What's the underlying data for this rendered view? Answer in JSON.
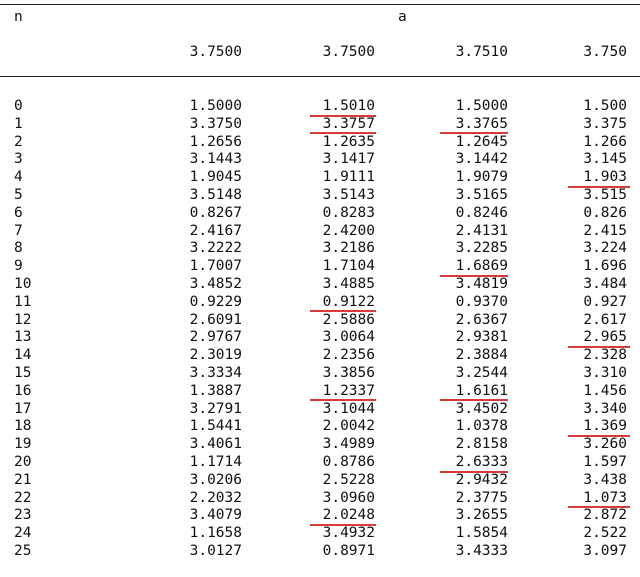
{
  "header": {
    "n_label": "n",
    "a_label": "a",
    "a_values": [
      "3.7500",
      "3.7500",
      "3.7510",
      "3.750"
    ]
  },
  "rows": [
    {
      "n": "0",
      "v": [
        "1.5000",
        "1.5010",
        "1.5000",
        "1.500"
      ],
      "u": [
        false,
        true,
        false,
        false
      ]
    },
    {
      "n": "1",
      "v": [
        "3.3750",
        "3.3757",
        "3.3765",
        "3.375"
      ],
      "u": [
        false,
        true,
        true,
        false
      ]
    },
    {
      "n": "2",
      "v": [
        "1.2656",
        "1.2635",
        "1.2645",
        "1.266"
      ],
      "u": [
        false,
        false,
        false,
        false
      ]
    },
    {
      "n": "3",
      "v": [
        "3.1443",
        "3.1417",
        "3.1442",
        "3.145"
      ],
      "u": [
        false,
        false,
        false,
        false
      ]
    },
    {
      "n": "4",
      "v": [
        "1.9045",
        "1.9111",
        "1.9079",
        "1.903"
      ],
      "u": [
        false,
        false,
        false,
        true
      ]
    },
    {
      "n": "5",
      "v": [
        "3.5148",
        "3.5143",
        "3.5165",
        "3.515"
      ],
      "u": [
        false,
        false,
        false,
        false
      ]
    },
    {
      "n": "6",
      "v": [
        "0.8267",
        "0.8283",
        "0.8246",
        "0.826"
      ],
      "u": [
        false,
        false,
        false,
        false
      ]
    },
    {
      "n": "7",
      "v": [
        "2.4167",
        "2.4200",
        "2.4131",
        "2.415"
      ],
      "u": [
        false,
        false,
        false,
        false
      ]
    },
    {
      "n": "8",
      "v": [
        "3.2222",
        "3.2186",
        "3.2285",
        "3.224"
      ],
      "u": [
        false,
        false,
        false,
        false
      ]
    },
    {
      "n": "9",
      "v": [
        "1.7007",
        "1.7104",
        "1.6869",
        "1.696"
      ],
      "u": [
        false,
        false,
        true,
        false
      ]
    },
    {
      "n": "10",
      "v": [
        "3.4852",
        "3.4885",
        "3.4819",
        "3.484"
      ],
      "u": [
        false,
        false,
        false,
        false
      ]
    },
    {
      "n": "11",
      "v": [
        "0.9229",
        "0.9122",
        "0.9370",
        "0.927"
      ],
      "u": [
        false,
        true,
        false,
        false
      ]
    },
    {
      "n": "12",
      "v": [
        "2.6091",
        "2.5886",
        "2.6367",
        "2.617"
      ],
      "u": [
        false,
        false,
        false,
        false
      ]
    },
    {
      "n": "13",
      "v": [
        "2.9767",
        "3.0064",
        "2.9381",
        "2.965"
      ],
      "u": [
        false,
        false,
        false,
        true
      ]
    },
    {
      "n": "14",
      "v": [
        "2.3019",
        "2.2356",
        "2.3884",
        "2.328"
      ],
      "u": [
        false,
        false,
        false,
        false
      ]
    },
    {
      "n": "15",
      "v": [
        "3.3334",
        "3.3856",
        "3.2544",
        "3.310"
      ],
      "u": [
        false,
        false,
        false,
        false
      ]
    },
    {
      "n": "16",
      "v": [
        "1.3887",
        "1.2337",
        "1.6161",
        "1.456"
      ],
      "u": [
        false,
        true,
        true,
        false
      ]
    },
    {
      "n": "17",
      "v": [
        "3.2791",
        "3.1044",
        "3.4502",
        "3.340"
      ],
      "u": [
        false,
        false,
        false,
        false
      ]
    },
    {
      "n": "18",
      "v": [
        "1.5441",
        "2.0042",
        "1.0378",
        "1.369"
      ],
      "u": [
        false,
        false,
        false,
        true
      ]
    },
    {
      "n": "19",
      "v": [
        "3.4061",
        "3.4989",
        "2.8158",
        "3.260"
      ],
      "u": [
        false,
        false,
        false,
        false
      ]
    },
    {
      "n": "20",
      "v": [
        "1.1714",
        "0.8786",
        "2.6333",
        "1.597"
      ],
      "u": [
        false,
        false,
        true,
        false
      ]
    },
    {
      "n": "21",
      "v": [
        "3.0206",
        "2.5228",
        "2.9432",
        "3.438"
      ],
      "u": [
        false,
        false,
        false,
        false
      ]
    },
    {
      "n": "22",
      "v": [
        "2.2032",
        "3.0960",
        "2.3775",
        "1.073"
      ],
      "u": [
        false,
        false,
        false,
        true
      ]
    },
    {
      "n": "23",
      "v": [
        "3.4079",
        "2.0248",
        "3.2655",
        "2.872"
      ],
      "u": [
        false,
        true,
        false,
        false
      ]
    },
    {
      "n": "24",
      "v": [
        "1.1658",
        "3.4932",
        "1.5854",
        "2.522"
      ],
      "u": [
        false,
        false,
        false,
        false
      ]
    },
    {
      "n": "25",
      "v": [
        "3.0127",
        "0.8971",
        "3.4333",
        "3.097"
      ],
      "u": [
        false,
        false,
        false,
        false
      ]
    }
  ],
  "colors": {
    "text": "#111111",
    "rule": "#222222",
    "underline": "#d63a3a"
  }
}
